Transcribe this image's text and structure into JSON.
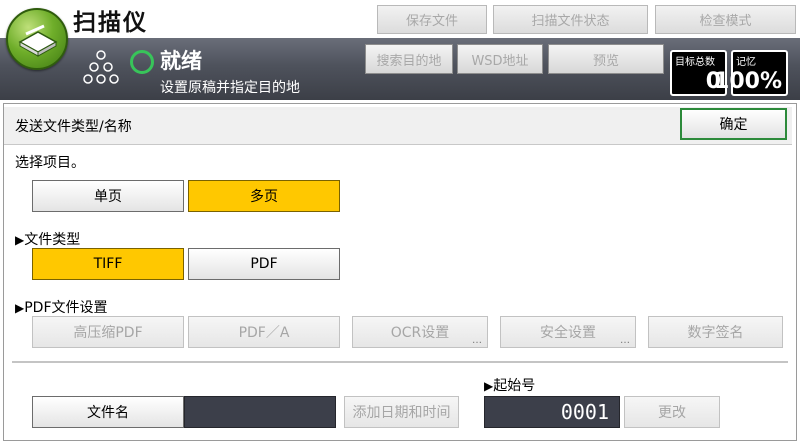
{
  "header": {
    "app_title": "扫描仪",
    "top_buttons": [
      "保存文件",
      "扫描文件状态",
      "检查模式"
    ],
    "status": {
      "title": "就绪",
      "subtitle": "设置原稿并指定目的地"
    },
    "dest_buttons": [
      "搜索目的地",
      "WSD地址",
      "预览"
    ],
    "counters": [
      {
        "label": "目标总数",
        "value": "0"
      },
      {
        "label": "记忆",
        "value": "100%"
      }
    ]
  },
  "panel": {
    "title": "发送文件类型/名称",
    "ok_label": "确定",
    "select_prompt": "选择项目。",
    "page_mode": {
      "options": [
        "单页",
        "多页"
      ],
      "selected": "多页"
    },
    "file_type": {
      "heading": "文件类型",
      "options": [
        "TIFF",
        "PDF"
      ],
      "selected": "TIFF"
    },
    "pdf_settings": {
      "heading": "PDF文件设置",
      "buttons": [
        "高压缩PDF",
        "PDF／A",
        "OCR设置",
        "安全设置",
        "数字签名"
      ]
    },
    "file_name": {
      "label": "文件名",
      "value": "",
      "add_date_label": "添加日期和时间"
    },
    "start_number": {
      "heading": "起始号",
      "value": "0001",
      "change_label": "更改"
    }
  },
  "colors": {
    "selected": "#ffc800",
    "ready": "#38c45a",
    "ok_border": "#2c8a3a"
  }
}
